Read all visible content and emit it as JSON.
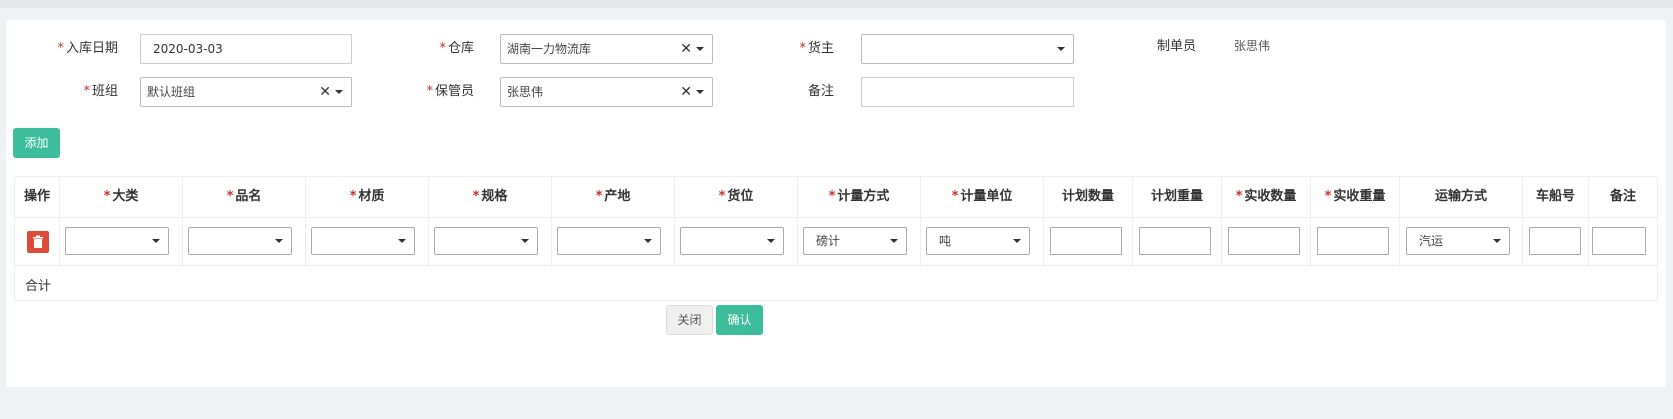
{
  "form": {
    "inbound_date": {
      "label": "入库日期",
      "value": "2020-03-03"
    },
    "warehouse": {
      "label": "仓库",
      "value": "湖南一力物流库"
    },
    "owner": {
      "label": "货主",
      "value": ""
    },
    "creator": {
      "label": "制单员",
      "value": "张思伟"
    },
    "team": {
      "label": "班组",
      "value": "默认班组"
    },
    "keeper": {
      "label": "保管员",
      "value": "张思伟"
    },
    "remark": {
      "label": "备注",
      "value": ""
    }
  },
  "required_mark": "*",
  "add_button": "添加",
  "table": {
    "columns": [
      {
        "label": "操作",
        "required": false
      },
      {
        "label": "大类",
        "required": true
      },
      {
        "label": "品名",
        "required": true
      },
      {
        "label": "材质",
        "required": true
      },
      {
        "label": "规格",
        "required": true
      },
      {
        "label": "产地",
        "required": true
      },
      {
        "label": "货位",
        "required": true
      },
      {
        "label": "计量方式",
        "required": true
      },
      {
        "label": "计量单位",
        "required": true
      },
      {
        "label": "计划数量",
        "required": false
      },
      {
        "label": "计划重量",
        "required": false
      },
      {
        "label": "实收数量",
        "required": true
      },
      {
        "label": "实收重量",
        "required": true
      },
      {
        "label": "运输方式",
        "required": false
      },
      {
        "label": "车船号",
        "required": false
      },
      {
        "label": "备注",
        "required": false
      }
    ],
    "row": {
      "measure_method": "磅计",
      "measure_unit": "吨",
      "transport": "汽运"
    },
    "total_label": "合计"
  },
  "buttons": {
    "close": "关闭",
    "confirm": "确认"
  },
  "icons": {
    "delete": "trash-icon",
    "clear": "close-icon",
    "dropdown": "caret-down-icon"
  },
  "colors": {
    "accent": "#3dbd9b",
    "danger": "#dd4b39",
    "required": "#c9302c"
  }
}
